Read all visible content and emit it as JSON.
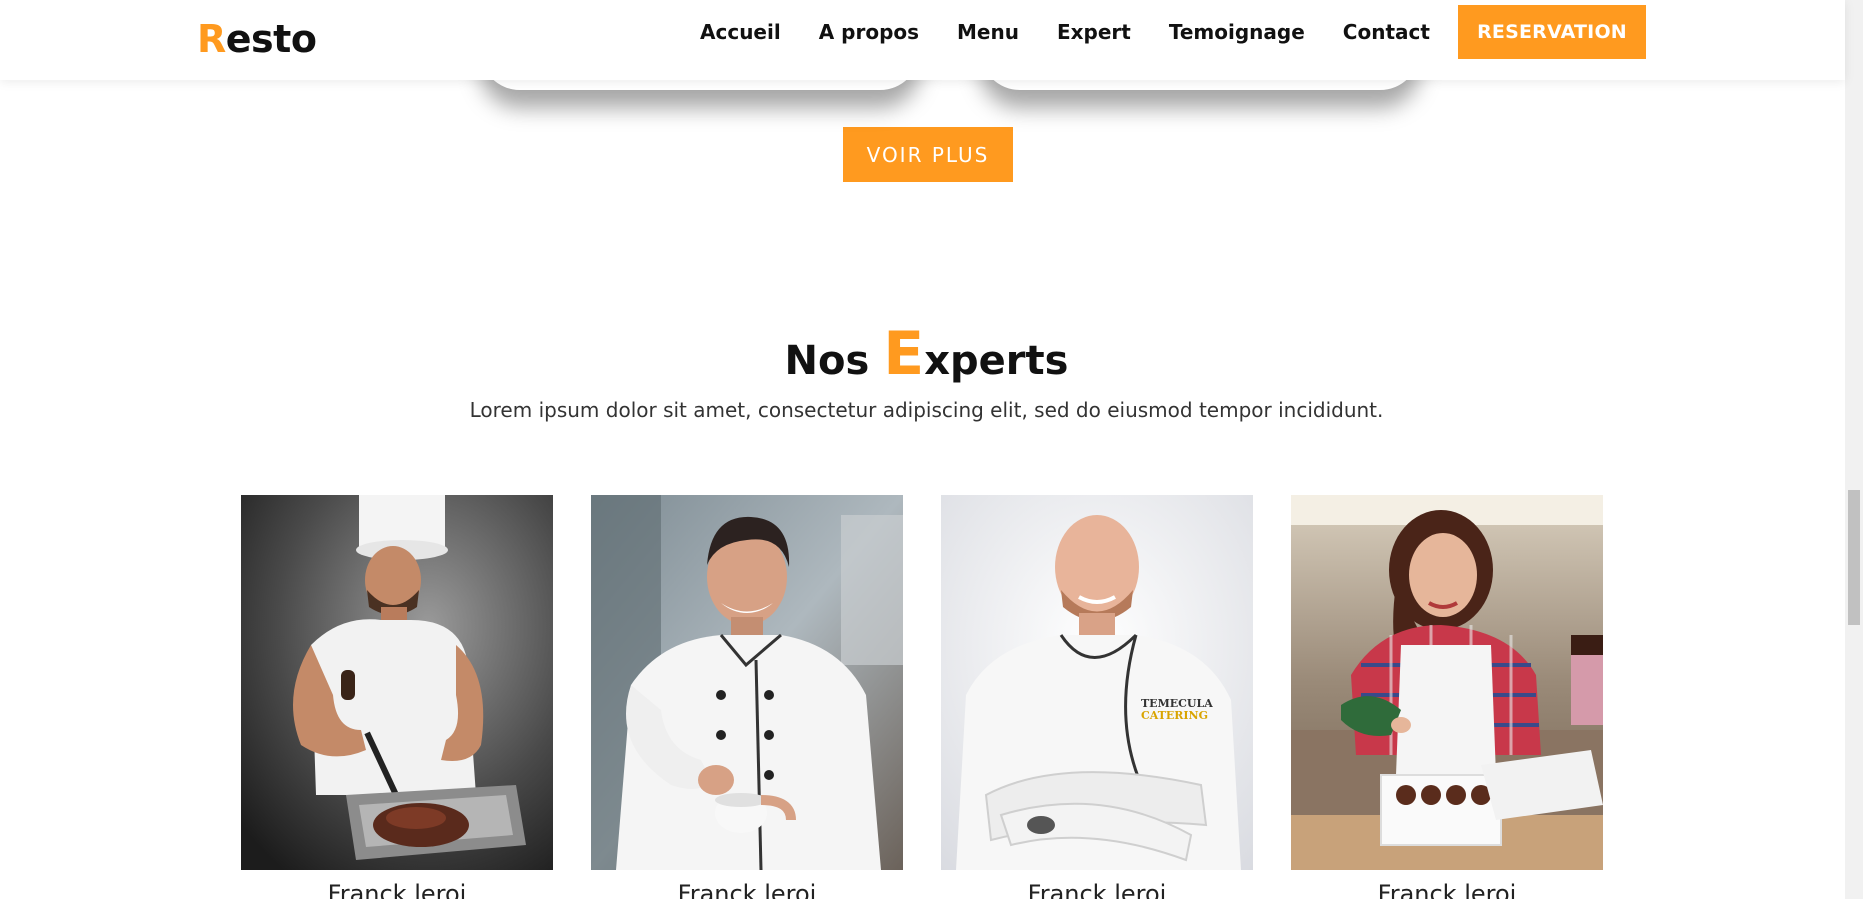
{
  "logo": {
    "accent": "R",
    "rest": "esto"
  },
  "nav": {
    "links": [
      "Accueil",
      "A propos",
      "Menu",
      "Expert",
      "Temoignage",
      "Contact"
    ],
    "reserve_label": "RESERVATION"
  },
  "more_button": {
    "label": "VOIR PLUS"
  },
  "experts_section": {
    "title_pre": "Nos",
    "title_accent": "E",
    "title_rest": "xperts",
    "subtitle": "Lorem ipsum dolor sit amet, consectetur adipiscing elit, sed do eiusmod tempor incididunt."
  },
  "experts": [
    {
      "name": "Franck leroi",
      "photo": "chef-cutting-meat-photo"
    },
    {
      "name": "Franck leroi",
      "photo": "chef-holding-cup-photo"
    },
    {
      "name": "Franck leroi",
      "photo": "chef-arms-crossed-photo"
    },
    {
      "name": "Franck leroi",
      "photo": "pastry-chef-decorating-photo"
    }
  ],
  "colors": {
    "accent": "#ff9a1f",
    "text": "#111111",
    "background": "#ffffff"
  }
}
